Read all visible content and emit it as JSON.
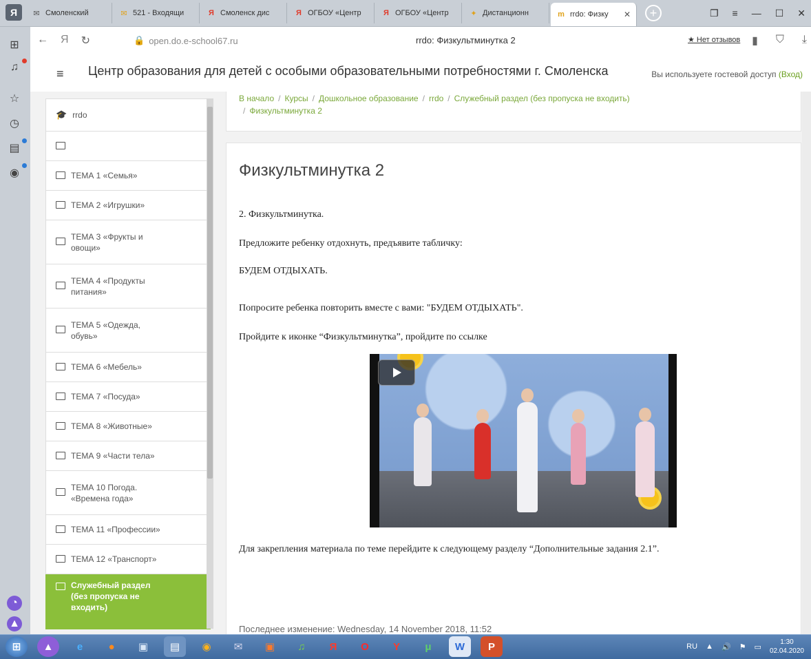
{
  "browser": {
    "tabs": [
      {
        "icon": "mail-icon",
        "icon_glyph": "✉",
        "label": "Смоленский"
      },
      {
        "icon": "mail-icon",
        "icon_glyph": "✉",
        "label": "521 - Входящи"
      },
      {
        "icon": "yandex-icon",
        "icon_glyph": "Я",
        "label": "Смоленск дис"
      },
      {
        "icon": "yandex-icon",
        "icon_glyph": "Я",
        "label": "ОГБОУ «Центр"
      },
      {
        "icon": "yandex-icon",
        "icon_glyph": "Я",
        "label": "ОГБОУ «Центр"
      },
      {
        "icon": "moodle-icon",
        "icon_glyph": "✦",
        "label": "Дистанционн"
      },
      {
        "icon": "moodle-icon",
        "icon_glyph": "m",
        "label": "rrdo: Физку"
      }
    ],
    "url_domain": "open.do.e-school67.ru",
    "page_title": "rrdo: Физкультминутка 2",
    "reviews_label": "★ Нет отзывов"
  },
  "header": {
    "site_title": "Центр образования для детей с особыми образовательными потребностями г. Смоленска",
    "guest_text": "Вы используете гостевой доступ",
    "login_link": "(Вход)"
  },
  "nav": {
    "course": "rrdo",
    "items": [
      {
        "label": ""
      },
      {
        "label": "ТЕМА 1 «Семья»"
      },
      {
        "label": "ТЕМА 2 «Игрушки»"
      },
      {
        "label": "ТЕМА 3 «Фрукты и овощи»"
      },
      {
        "label": "ТЕМА 4 «Продукты питания»"
      },
      {
        "label": "ТЕМА 5 «Одежда, обувь»"
      },
      {
        "label": "ТЕМА 6 «Мебель»"
      },
      {
        "label": "ТЕМА 7 «Посуда»"
      },
      {
        "label": "ТЕМА 8 «Животные»"
      },
      {
        "label": "ТЕМА 9 «Части тела»"
      },
      {
        "label": "ТЕМА 10 Погода. «Времена года»"
      },
      {
        "label": "ТЕМА 11 «Профессии»"
      },
      {
        "label": "ТЕМА 12 «Транспорт»"
      },
      {
        "label": "Служебный раздел (без пропуска не входить)"
      }
    ]
  },
  "breadcrumbs": [
    "В начало",
    "Курсы",
    "Дошкольное образование",
    "rrdo",
    "Служебный раздел (без пропуска не входить)",
    "Физкультминутка 2"
  ],
  "page": {
    "heading": "Физкультминутка 2",
    "p1": "2. Физкультминутка.",
    "p2": "Предложите ребенку отдохнуть, предъявите табличку:",
    "p3": "БУДЕМ ОТДЫХАТЬ.",
    "p4": "Попросите ребенка повторить вместе с вами: \"БУДЕМ ОТДЫХАТЬ\".",
    "p5": "Пройдите к иконке “Физкультминутка”, пройдите по ссылке",
    "p6": "Для закрепления материала по теме  перейдите к следующему разделу “Дополнительные задания 2.1”.",
    "last_modified": "Последнее изменение: Wednesday, 14 November 2018, 11:52"
  },
  "taskbar": {
    "lang": "RU",
    "time": "1:30",
    "date": "02.04.2020"
  },
  "colors": {
    "accent_green": "#8bbf3a",
    "link_green": "#7aa83a"
  }
}
